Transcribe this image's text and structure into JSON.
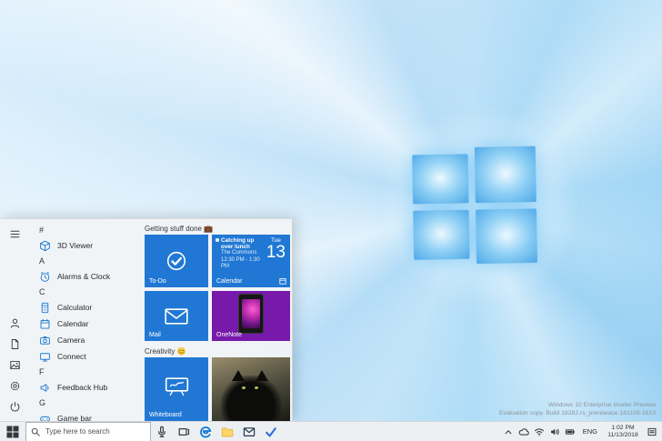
{
  "colors": {
    "accent": "#0078d7",
    "tile_blue": "#2178d4",
    "onenote_purple": "#7719aa"
  },
  "watermark": {
    "line1": "Windows 10 Enterprise Insider Preview",
    "line2": "Evaluation copy. Build 18282.rs_prerelease.181109-1613"
  },
  "start": {
    "app_list": [
      {
        "type": "header",
        "label": "#"
      },
      {
        "type": "app",
        "label": "3D Viewer"
      },
      {
        "type": "header",
        "label": "A"
      },
      {
        "type": "app",
        "label": "Alarms & Clock"
      },
      {
        "type": "header",
        "label": "C"
      },
      {
        "type": "app",
        "label": "Calculator"
      },
      {
        "type": "app",
        "label": "Calendar"
      },
      {
        "type": "app",
        "label": "Camera"
      },
      {
        "type": "app",
        "label": "Connect"
      },
      {
        "type": "header",
        "label": "F"
      },
      {
        "type": "app",
        "label": "Feedback Hub"
      },
      {
        "type": "header",
        "label": "G"
      },
      {
        "type": "app",
        "label": "Game bar"
      }
    ],
    "groups": [
      {
        "title": "Getting stuff done 💼"
      },
      {
        "title": "Creativity 😊"
      }
    ],
    "tiles": {
      "todo": {
        "label": "To-Do"
      },
      "calendar": {
        "label": "Calendar",
        "event_title": "Catching up over lunch",
        "event_location": "The Commons",
        "event_time": "12:30 PM - 1:30 PM",
        "weekday": "Tue",
        "day": "13"
      },
      "mail": {
        "label": "Mail"
      },
      "onenote": {
        "label": "OneNote"
      },
      "whiteboard": {
        "label": "Whiteboard"
      }
    }
  },
  "taskbar": {
    "search_placeholder": "Type here to search",
    "tray": {
      "language": "ENG",
      "time": "1:02 PM",
      "date": "11/13/2018"
    }
  }
}
